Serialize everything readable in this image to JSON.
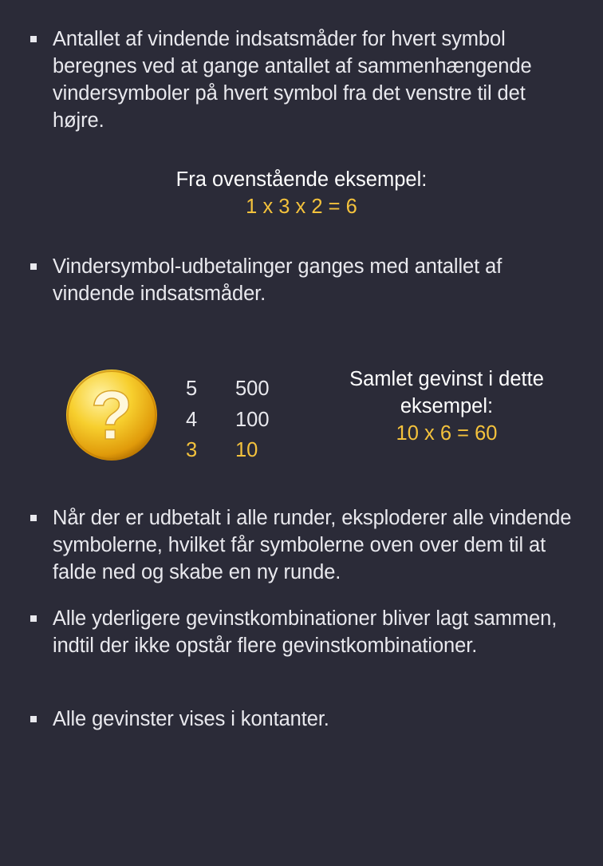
{
  "bullets_top": [
    "Antallet af vindende indsatsmåder for hvert symbol beregnes ved at gange antallet af sammenhængende vindersymboler på hvert symbol fra det venstre til det højre."
  ],
  "example": {
    "heading": "Fra ovenstående eksempel:",
    "formula": "1 x 3 x 2 = 6"
  },
  "bullet_middle": "Vindersymbol-udbetalinger ganges med antallet af vindende indsatsmåder.",
  "paytable": {
    "symbol_icon": "question-mark-coin-icon",
    "rows": [
      {
        "count": "5",
        "payout": "500",
        "highlight": false
      },
      {
        "count": "4",
        "payout": "100",
        "highlight": false
      },
      {
        "count": "3",
        "payout": "10",
        "highlight": true
      }
    ]
  },
  "total": {
    "line1": "Samlet gevinst i dette",
    "line2": "eksempel:",
    "formula": "10 x 6 = 60"
  },
  "bullets_bottom": [
    "Når der er udbetalt i alle runder, eksploderer alle vindende symbolerne, hvilket får symbolerne oven over dem til at falde ned og skabe en ny runde.",
    "Alle yderligere gevinstkombinationer bliver lagt sammen, indtil der ikke opstår flere gevinstkombinationer.",
    "Alle gevinster vises i kontanter."
  ],
  "colors": {
    "background": "#2b2b38",
    "text": "#e9e9ee",
    "highlight": "#f4c23c"
  }
}
